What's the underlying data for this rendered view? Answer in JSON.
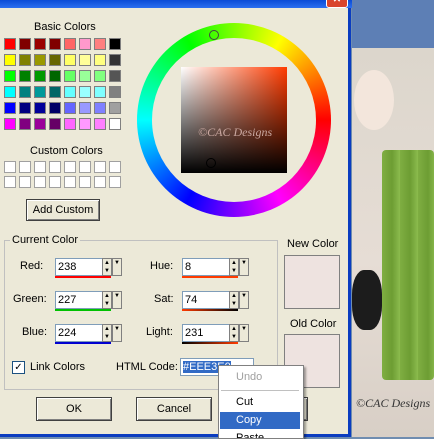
{
  "dialog": {
    "close_glyph": "✕",
    "basic_colors_label": "Basic Colors",
    "basic_colors": [
      [
        "#ff0000",
        "#800000",
        "#990000",
        "#800000",
        "#ff6666",
        "#ff99cc",
        "#ff8080",
        "#000000"
      ],
      [
        "#ffff00",
        "#808000",
        "#999900",
        "#666600",
        "#ffff66",
        "#ffff99",
        "#ffff80",
        "#333333"
      ],
      [
        "#00ff00",
        "#008000",
        "#009900",
        "#006600",
        "#66ff66",
        "#99ff99",
        "#80ff80",
        "#555555"
      ],
      [
        "#00ffff",
        "#008080",
        "#009999",
        "#006666",
        "#66ffff",
        "#99ffff",
        "#80ffff",
        "#808080"
      ],
      [
        "#0000ff",
        "#000080",
        "#000099",
        "#000066",
        "#6666ff",
        "#9999ff",
        "#8080ff",
        "#a0a0a0"
      ],
      [
        "#ff00ff",
        "#800080",
        "#990099",
        "#660066",
        "#ff66ff",
        "#ff99ff",
        "#ff80ff",
        "#ffffff"
      ]
    ],
    "custom_colors_label": "Custom Colors",
    "add_custom_label": "Add Custom",
    "current_color_label": "Current Color",
    "red_label": "Red:",
    "red_value": "238",
    "green_label": "Green:",
    "green_value": "227",
    "blue_label": "Blue:",
    "blue_value": "224",
    "hue_label": "Hue:",
    "hue_value": "8",
    "sat_label": "Sat:",
    "sat_value": "74",
    "light_label": "Light:",
    "light_value": "231",
    "new_color_label": "New Color",
    "new_color": "#eee3e0",
    "old_color_label": "Old Color",
    "old_color": "#eee3e0",
    "link_colors_label": "Link Colors",
    "link_colors_checked": true,
    "html_code_label": "HTML Code:",
    "html_code_value": "#EEE3E0",
    "ok_label": "OK",
    "cancel_label": "Cancel",
    "watermark": "©CAC Designs",
    "accent_color": "#ff3b00"
  },
  "context_menu": {
    "undo": "Undo",
    "cut": "Cut",
    "copy": "Copy",
    "paste": "Paste"
  },
  "background": {
    "watermark": "©CAC Designs"
  }
}
